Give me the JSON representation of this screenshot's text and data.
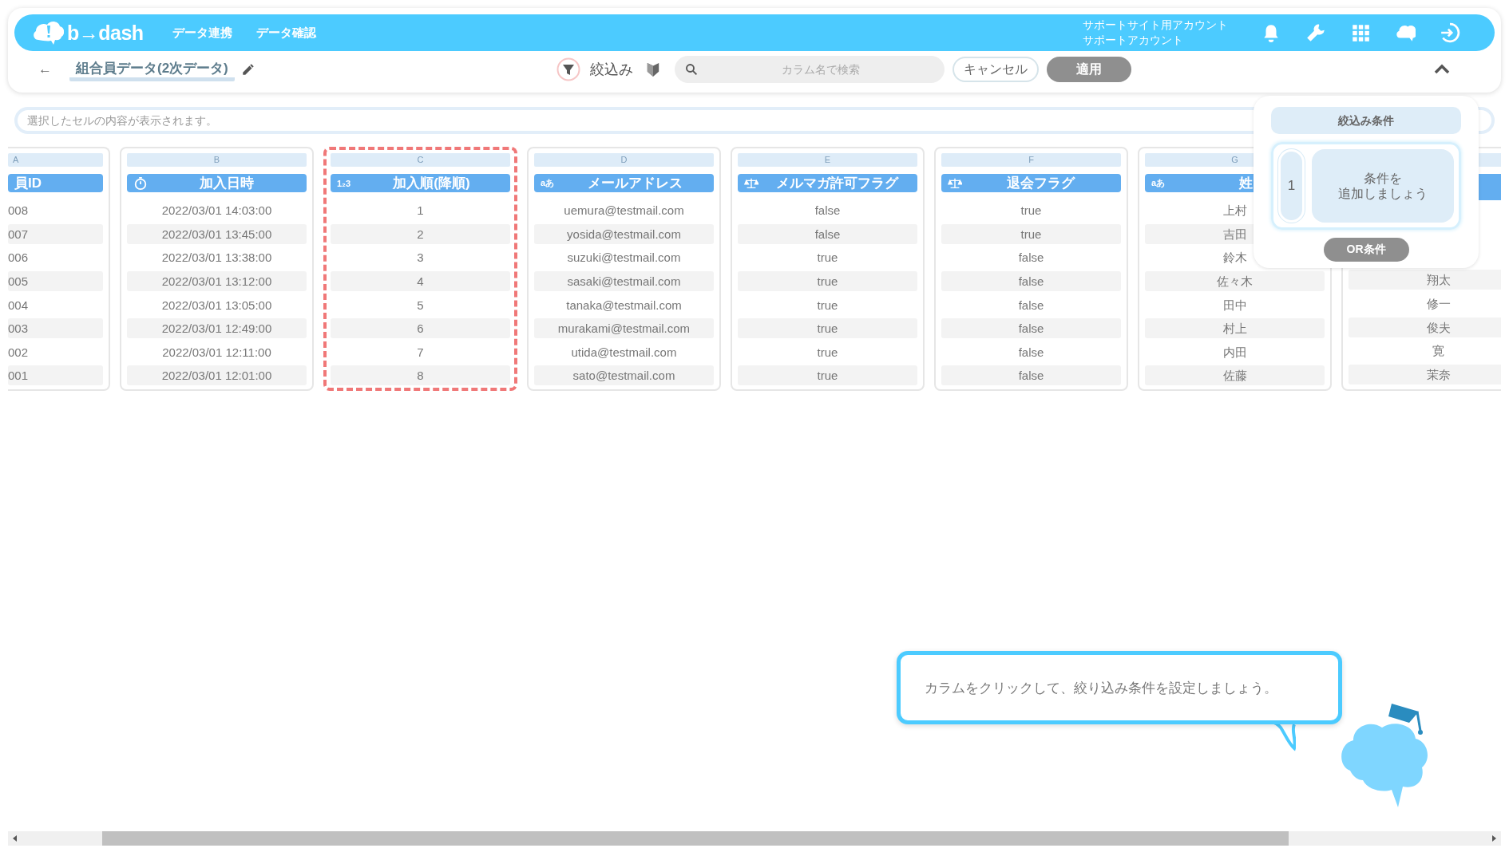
{
  "header": {
    "logo": "b→dash",
    "nav": [
      {
        "label": "データ連携"
      },
      {
        "label": "データ確認"
      }
    ],
    "account": [
      "サポートサイト用アカウント",
      "サポートアカウント"
    ]
  },
  "toolbar": {
    "back": "←",
    "title": "組合員データ(2次データ)",
    "filter_label": "絞込み",
    "search": {
      "placeholder": "カラム名で検索"
    },
    "buttons": [
      {
        "label": "キャンセル",
        "disabled": false
      },
      {
        "label": "適用",
        "disabled": true
      }
    ]
  },
  "cell_bar": {
    "placeholder": "選択したセルの内容が表示されます。"
  },
  "columns": [
    {
      "letter": "A",
      "title": "員ID",
      "kind": "clipped",
      "selected": false,
      "cells": [
        "008",
        "007",
        "006",
        "005",
        "004",
        "003",
        "002",
        "001"
      ]
    },
    {
      "letter": "B",
      "title": "加入日時",
      "kind": "datetime",
      "selected": false,
      "cells": [
        "2022/03/01 14:03:00",
        "2022/03/01 13:45:00",
        "2022/03/01 13:38:00",
        "2022/03/01 13:12:00",
        "2022/03/01 13:05:00",
        "2022/03/01 12:49:00",
        "2022/03/01 12:11:00",
        "2022/03/01 12:01:00"
      ]
    },
    {
      "letter": "C",
      "title": "加入順(降順)",
      "kind": "number",
      "icon_text": "1₂3",
      "selected": true,
      "cells": [
        "1",
        "2",
        "3",
        "4",
        "5",
        "6",
        "7",
        "8"
      ]
    },
    {
      "letter": "D",
      "title": "メールアドレス",
      "kind": "text",
      "icon_text": "aあ",
      "selected": false,
      "cells": [
        "uemura@testmail.com",
        "yosida@testmail.com",
        "suzuki@testmail.com",
        "sasaki@testmail.com",
        "tanaka@testmail.com",
        "murakami@testmail.com",
        "utida@testmail.com",
        "sato@testmail.com"
      ]
    },
    {
      "letter": "E",
      "title": "メルマガ許可フラグ",
      "kind": "boolean",
      "selected": false,
      "cells": [
        "false",
        "false",
        "true",
        "true",
        "true",
        "true",
        "true",
        "true"
      ]
    },
    {
      "letter": "F",
      "title": "退会フラグ",
      "kind": "boolean",
      "selected": false,
      "cells": [
        "true",
        "true",
        "false",
        "false",
        "false",
        "false",
        "false",
        "false"
      ]
    },
    {
      "letter": "G",
      "title": "姓",
      "kind": "text",
      "icon_text": "aあ",
      "selected": false,
      "cells": [
        "上村",
        "吉田",
        "鈴木",
        "佐々木",
        "田中",
        "村上",
        "内田",
        "佐藤"
      ]
    },
    {
      "kind": "covered",
      "selected": false,
      "cells": [
        "翔太",
        "修一",
        "俊夫",
        "寛",
        "茉奈"
      ]
    }
  ],
  "filter_popup": {
    "title": "絞込み条件",
    "groups": [
      {
        "number": "1",
        "placeholder_lines": [
          "条件を",
          "追加しましょう"
        ]
      }
    ],
    "or_button": {
      "label": "OR条件",
      "disabled": true
    }
  },
  "hint": "カラムをクリックして、絞り込み条件を設定しましょう。"
}
